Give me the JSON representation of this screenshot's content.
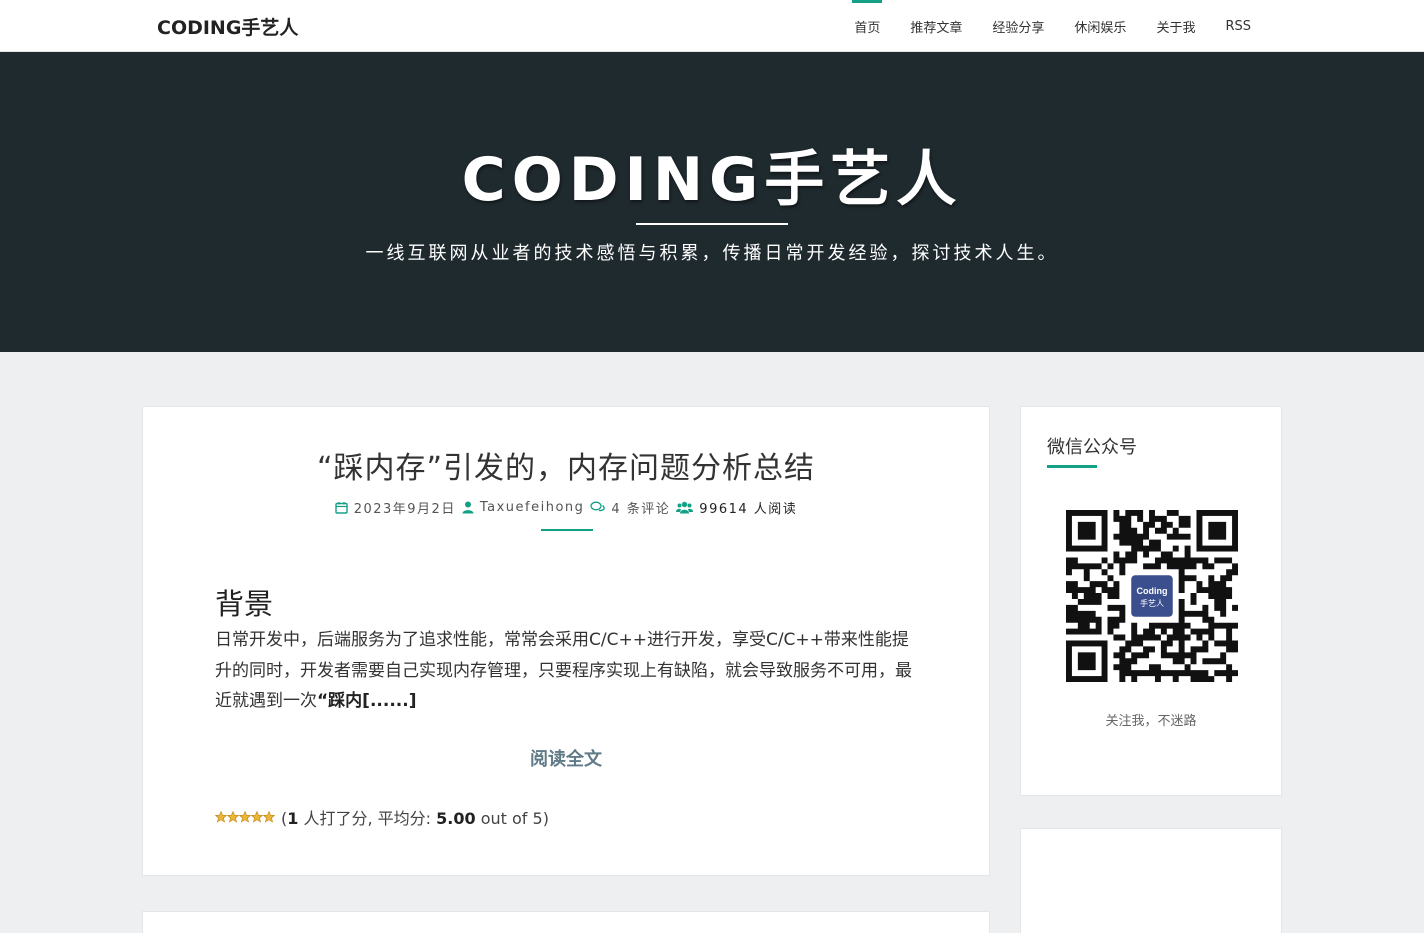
{
  "header": {
    "brand": "CODING手艺人",
    "nav": [
      {
        "label": "首页",
        "active": true
      },
      {
        "label": "推荐文章",
        "active": false
      },
      {
        "label": "经验分享",
        "active": false
      },
      {
        "label": "休闲娱乐",
        "active": false
      },
      {
        "label": "关于我",
        "active": false
      },
      {
        "label": "RSS",
        "active": false
      }
    ]
  },
  "hero": {
    "title": "CODING手艺人",
    "subtitle": "一线互联网从业者的技术感悟与积累，传播日常开发经验，探讨技术人生。"
  },
  "post": {
    "title": "“踩内存”引发的，内存问题分析总结",
    "date": "2023年9月2日",
    "author": "Taxuefeihong",
    "comments": "4 条评论",
    "readers": "99614 人阅读",
    "section_heading": "背景",
    "excerpt_text": "日常开发中，后端服务为了追求性能，常常会采用C/C++进行开发，享受C/C++带来性能提升的同时，开发者需要自己实现内存管理，只要程序实现上有缺陷，就会导致服务不可用，最近就遇到一次",
    "excerpt_bold": "“踩内[......]",
    "read_more": "阅读全文",
    "rating": {
      "stars": 5,
      "open": "(",
      "count": "1",
      "count_text": " 人打了分, 平均分: ",
      "average": "5.00",
      "suffix": " out of 5)"
    }
  },
  "sidebar": {
    "widget_title": "微信公众号",
    "qr_logo_line1": "Coding",
    "qr_logo_line2": "手艺人",
    "qr_caption": "关注我，不迷路"
  },
  "colors": {
    "accent": "#14a085",
    "hero_bg": "#1f2a2f",
    "read_more": "#607b87",
    "star": "#e3a21a"
  },
  "icons": {
    "date": "calendar-icon",
    "author": "user-icon",
    "comments": "comments-icon",
    "readers": "users-icon",
    "rating": "star-icon"
  }
}
